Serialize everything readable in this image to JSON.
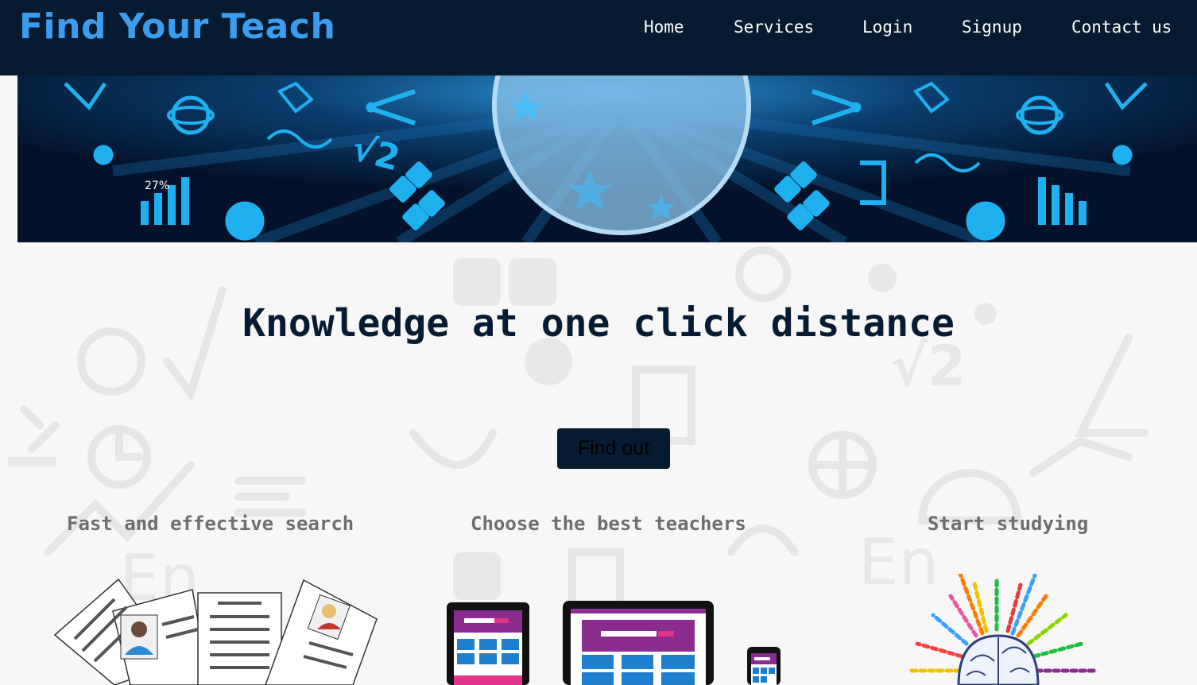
{
  "header": {
    "brand": "Find Your Teach",
    "nav": [
      {
        "label": "Home"
      },
      {
        "label": "Services"
      },
      {
        "label": "Login"
      },
      {
        "label": "Signup"
      },
      {
        "label": "Contact us"
      }
    ]
  },
  "banner": {
    "stat_text": "27%",
    "formula_text": "√2"
  },
  "hero": {
    "headline": "Knowledge at one click distance",
    "cta_label": "Find out"
  },
  "features": [
    {
      "title": "Fast and effective search",
      "icon": "resume-documents-icon"
    },
    {
      "title": "Choose the best teachers",
      "icon": "responsive-devices-icon"
    },
    {
      "title": "Start studying",
      "icon": "colorful-brain-icon"
    }
  ],
  "colors": {
    "header_bg": "#061a30",
    "brand": "#3c9df0",
    "banner_accent": "#1fb0f0",
    "headline": "#071c33",
    "feature_title": "#6e6e6e"
  }
}
